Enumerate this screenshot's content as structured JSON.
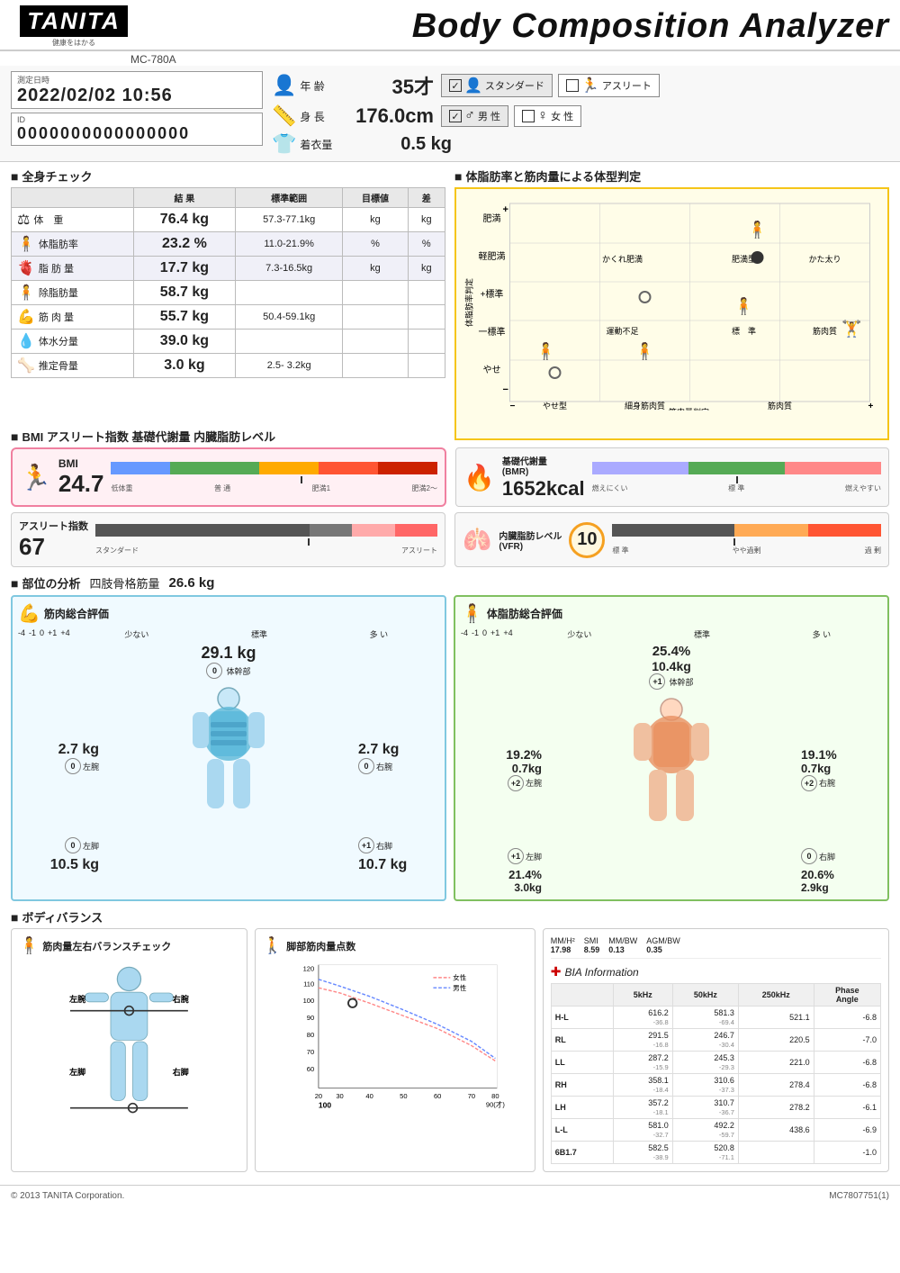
{
  "header": {
    "brand": "TANITA",
    "brand_sub": "健康をはかる",
    "title": "Body Composition Analyzer",
    "model": "MC-780A"
  },
  "info": {
    "date_label": "測定日時",
    "date_value": "2022/02/02  10:56",
    "id_label": "ID",
    "id_value": "0000000000000000",
    "age_label": "年 齢",
    "age_value": "35才",
    "height_label": "身 長",
    "height_value": "176.0cm",
    "clothes_label": "着衣量",
    "clothes_value": "0.5 kg",
    "mode_standard": "スタンダード",
    "mode_athlete": "アスリート",
    "gender_male": "男 性",
    "gender_female": "女 性",
    "mode_standard_checked": true,
    "mode_athlete_checked": false,
    "gender_male_checked": true,
    "gender_female_checked": false
  },
  "body_check": {
    "section_title": "全身チェック",
    "col_result": "結 果",
    "col_range": "標準範囲",
    "col_target": "目標値",
    "col_diff": "差",
    "rows": [
      {
        "label": "体　重",
        "result": "76.4 kg",
        "range": "57.3-77.1kg",
        "target": "kg",
        "diff": "kg",
        "shaded": false
      },
      {
        "label": "体脂肪率",
        "result": "23.2 %",
        "range": "11.0-21.9%",
        "target": "%",
        "diff": "%",
        "shaded": true
      },
      {
        "label": "脂 肪 量",
        "result": "17.7 kg",
        "range": "7.3-16.5kg",
        "target": "kg",
        "diff": "kg",
        "shaded": true
      },
      {
        "label": "除脂肪量",
        "result": "58.7 kg",
        "range": "",
        "target": "",
        "diff": "",
        "shaded": false
      },
      {
        "label": "筋 肉 量",
        "result": "55.7 kg",
        "range": "50.4-59.1kg",
        "target": "",
        "diff": "",
        "shaded": false
      },
      {
        "label": "体水分量",
        "result": "39.0 kg",
        "range": "",
        "target": "",
        "diff": "",
        "shaded": false
      },
      {
        "label": "推定骨量",
        "result": "3.0 kg",
        "range": "2.5- 3.2kg",
        "target": "",
        "diff": "",
        "shaded": false
      }
    ]
  },
  "body_type": {
    "section_title": "体脂肪率と筋肉量による体型判定",
    "y_labels": [
      "肥満",
      "軽肥満",
      "+標準",
      "一標準",
      "やせ"
    ],
    "x_labels": [
      "やせ型",
      "細身筋肉質",
      "筋肉質"
    ],
    "cells": [
      "かくれ肥満",
      "肥満型●",
      "かた太り",
      "運動不足",
      "標　準",
      "筋肉質"
    ]
  },
  "bmi": {
    "section_title": "BMI アスリート指数 基礎代謝量 内臓脂肪レベル",
    "bmi_label": "BMI",
    "bmi_value": "24.7",
    "bmi_gauge_labels": [
      "低体重",
      "普 通",
      "肥満1",
      "肥満2〜"
    ],
    "bmr_label": "基礎代謝量\n(BMR)",
    "bmr_value": "1652kcal",
    "bmr_gauge_labels": [
      "燃えにくい",
      "標 準",
      "燃えやすい"
    ],
    "athlete_label": "アスリート指数",
    "athlete_value": "67",
    "athlete_gauge_labels": [
      "スタンダード",
      "アスリート"
    ],
    "vfr_label": "内臓脂肪レベル\n(VFR)",
    "vfr_value": "10",
    "vfr_gauge_labels": [
      "標 準",
      "やや過剰",
      "過 剰"
    ]
  },
  "parts": {
    "section_title": "部位の分析",
    "skeletal_label": "四肢骨格筋量",
    "skeletal_value": "26.6 kg",
    "muscle_box_title": "筋肉総合評価",
    "fat_box_title": "体脂肪総合評価",
    "scale_labels": [
      "-4",
      "-1",
      "0",
      "+1",
      "+4"
    ],
    "scale_sub_labels": [
      "少ない",
      "標準",
      "多 い"
    ],
    "muscle": {
      "trunk_val": "29.1 kg",
      "trunk_label": "体幹部",
      "trunk_badge": "0",
      "left_arm_val": "2.7 kg",
      "left_arm_label": "左腕",
      "left_arm_badge": "0",
      "right_arm_val": "2.7 kg",
      "right_arm_label": "右腕",
      "right_arm_badge": "0",
      "left_leg_val": "10.5 kg",
      "left_leg_label": "左脚",
      "left_leg_badge": "0",
      "right_leg_val": "10.7 kg",
      "right_leg_label": "右脚",
      "right_leg_badge": "+1"
    },
    "fat": {
      "trunk_pct": "25.4%",
      "trunk_val": "10.4kg",
      "trunk_label": "体幹部",
      "trunk_badge": "+1",
      "left_arm_pct": "19.2%",
      "left_arm_val": "0.7kg",
      "left_arm_label": "左腕",
      "left_arm_badge": "+2",
      "right_arm_pct": "19.1%",
      "right_arm_val": "0.7kg",
      "right_arm_label": "右腕",
      "right_arm_badge": "+2",
      "left_leg_pct": "21.4%",
      "left_leg_val": "3.0kg",
      "left_leg_label": "左脚",
      "left_leg_badge": "+1",
      "right_leg_pct": "20.6%",
      "right_leg_val": "2.9kg",
      "right_leg_label": "右脚",
      "right_leg_badge": "0"
    }
  },
  "balance": {
    "section_title": "ボディバランス",
    "muscle_balance_title": "筋肉量左右バランスチェック",
    "leg_score_title": "脚部筋肉量点数",
    "female_label": "女性",
    "male_label": "男性",
    "score_value": "100",
    "extra_labels": {
      "mm_h2": "MM/H²",
      "mm_h2_val": "17.98",
      "smi": "SMI",
      "smi_val": "8.59",
      "mm_bw": "MM/BW",
      "mm_bw_val": "0.13",
      "agm_bw": "AGM/BW",
      "agm_bw_val": "0.35"
    }
  },
  "bia": {
    "title": "BIA Information",
    "headers": [
      "",
      "5kHz",
      "50kHz",
      "250kHz",
      "Phase\nAngle"
    ],
    "rows": [
      {
        "label": "H-L",
        "v5": "616.2",
        "v50": "581.3",
        "v250": "521.1",
        "phase": "-6.8",
        "prefix": "-36.8",
        "prefix50": "-69.4"
      },
      {
        "label": "RL",
        "v5": "291.5",
        "v50": "246.7",
        "v250": "220.5",
        "phase": "-7.0",
        "prefix": "-16.8",
        "prefix50": "-30.4"
      },
      {
        "label": "LL",
        "v5": "287.2",
        "v50": "245.3",
        "v250": "221.0",
        "phase": "-6.8",
        "prefix": "-15.9",
        "prefix50": "-29.3"
      },
      {
        "label": "RH",
        "v5": "358.1",
        "v50": "310.6",
        "v250": "278.4",
        "phase": "-6.8",
        "prefix": "-18.4",
        "prefix50": "-37.3"
      },
      {
        "label": "LH",
        "v5": "357.2",
        "v50": "310.7",
        "v250": "278.2",
        "phase": "-6.1",
        "prefix": "-18.1",
        "prefix50": "-36.7"
      },
      {
        "label": "L-L",
        "v5": "581.0",
        "v50": "492.2",
        "v250": "438.6",
        "phase": "-6.9",
        "prefix": "-32.7",
        "prefix50": "-59.7"
      },
      {
        "label": "6B1.7",
        "v5": "582.5",
        "v50": "520.8",
        "v250": "",
        "phase": "-1.0",
        "prefix": "-38.9",
        "prefix50": "-71.1"
      }
    ]
  },
  "footer": {
    "copyright": "© 2013 TANITA Corporation.",
    "model_code": "MC7807751(1)"
  }
}
